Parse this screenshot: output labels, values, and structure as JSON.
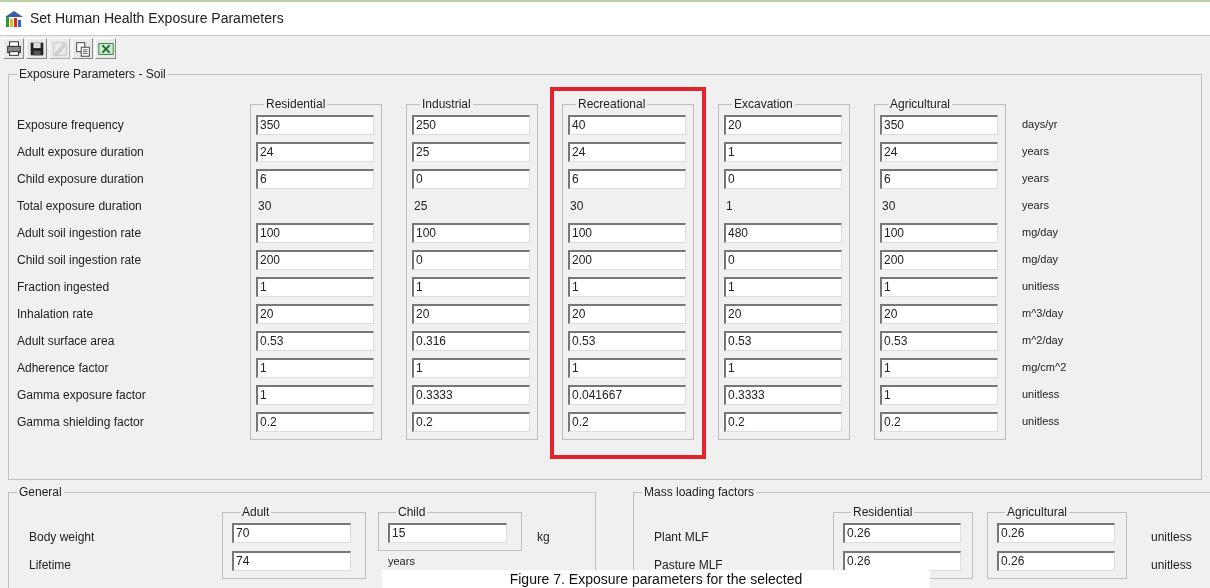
{
  "window": {
    "title": "Set Human Health Exposure Parameters"
  },
  "toolbar": [
    {
      "kind": "print",
      "disabled": false
    },
    {
      "kind": "save",
      "disabled": false
    },
    {
      "kind": "edit",
      "disabled": true
    },
    {
      "kind": "copy",
      "disabled": false
    },
    {
      "kind": "excel",
      "disabled": false
    }
  ],
  "soil": {
    "title": "Exposure Parameters - Soil",
    "columns": [
      {
        "label": "Residential",
        "highlighted": false
      },
      {
        "label": "Industrial",
        "highlighted": false
      },
      {
        "label": "Recreational",
        "highlighted": true
      },
      {
        "label": "Excavation",
        "highlighted": false
      },
      {
        "label": "Agricultural",
        "highlighted": false
      }
    ],
    "rows": [
      {
        "label": "Exposure frequency",
        "kind": "field",
        "values": [
          "350",
          "250",
          "40",
          "20",
          "350"
        ],
        "unit": "days/yr"
      },
      {
        "label": "Adult exposure duration",
        "kind": "field",
        "values": [
          "24",
          "25",
          "24",
          "1",
          "24"
        ],
        "unit": "years"
      },
      {
        "label": "Child exposure duration",
        "kind": "field",
        "values": [
          "6",
          "0",
          "6",
          "0",
          "6"
        ],
        "unit": "years"
      },
      {
        "label": "Total exposure duration",
        "kind": "computed",
        "values": [
          "30",
          "25",
          "30",
          "1",
          "30"
        ],
        "unit": "years"
      },
      {
        "label": "Adult soil ingestion rate",
        "kind": "field",
        "values": [
          "100",
          "100",
          "100",
          "480",
          "100"
        ],
        "unit": "mg/day"
      },
      {
        "label": "Child soil ingestion rate",
        "kind": "field",
        "values": [
          "200",
          "0",
          "200",
          "0",
          "200"
        ],
        "unit": "mg/day"
      },
      {
        "label": "Fraction ingested",
        "kind": "field",
        "values": [
          "1",
          "1",
          "1",
          "1",
          "1"
        ],
        "unit": "unitless"
      },
      {
        "label": "Inhalation rate",
        "kind": "field",
        "values": [
          "20",
          "20",
          "20",
          "20",
          "20"
        ],
        "unit": "m^3/day"
      },
      {
        "label": "Adult surface area",
        "kind": "field",
        "values": [
          "0.53",
          "0.316",
          "0.53",
          "0.53",
          "0.53"
        ],
        "unit": "m^2/day"
      },
      {
        "label": "Adherence factor",
        "kind": "field",
        "values": [
          "1",
          "1",
          "1",
          "1",
          "1"
        ],
        "unit": "mg/cm^2"
      },
      {
        "label": "Gamma exposure factor",
        "kind": "field",
        "values": [
          "1",
          "0.3333",
          "0.041667",
          "0.3333",
          "1"
        ],
        "unit": "unitless"
      },
      {
        "label": "Gamma shielding factor",
        "kind": "field",
        "values": [
          "0.2",
          "0.2",
          "0.2",
          "0.2",
          "0.2"
        ],
        "unit": "unitless"
      }
    ]
  },
  "general": {
    "title": "General",
    "columns": [
      "Adult",
      "Child"
    ],
    "rows": [
      {
        "label": "Body weight",
        "values": [
          "70",
          "15"
        ],
        "unit": "kg"
      },
      {
        "label": "Lifetime",
        "values": [
          "74"
        ],
        "unit": "years"
      }
    ]
  },
  "mass_loading": {
    "title": "Mass loading factors",
    "columns": [
      "Residential",
      "Agricultural"
    ],
    "rows": [
      {
        "label": "Plant MLF",
        "values": [
          "0.26",
          "0.26"
        ],
        "unit": "unitless"
      },
      {
        "label": "Pasture MLF",
        "values": [
          "0.26",
          "0.26"
        ],
        "unit": "unitless"
      }
    ]
  },
  "caption": "Figure 7. Exposure parameters for the selected"
}
